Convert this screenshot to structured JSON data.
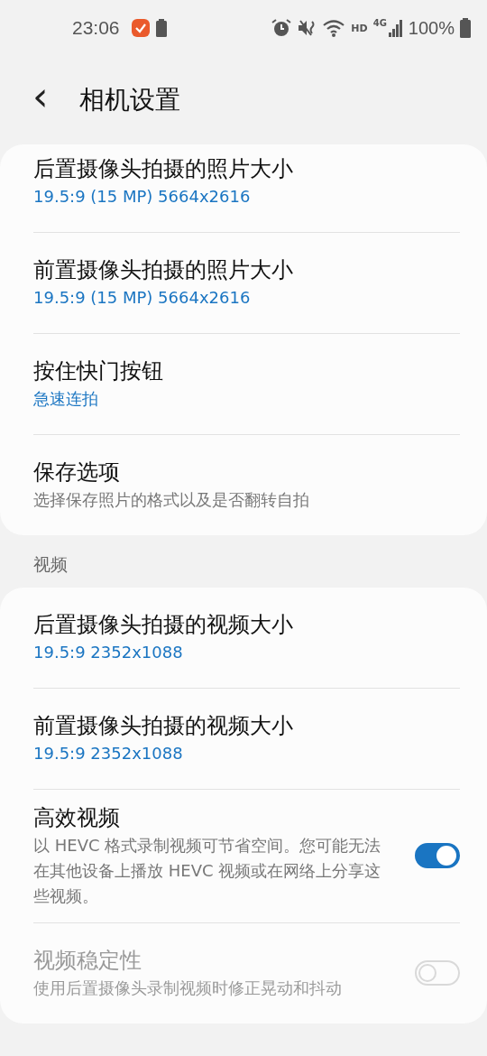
{
  "status_bar": {
    "time": "23:06",
    "battery_text": "100%",
    "network": "4G",
    "hd": "HD"
  },
  "header": {
    "back": "‹",
    "title": "相机设置"
  },
  "sections": [
    {
      "items": [
        {
          "title": "后置摄像头拍摄的照片大小",
          "subtitle": "19.5:9 (15 MP) 5664x2616",
          "kind": "value",
          "disabled": false
        },
        {
          "title": "前置摄像头拍摄的照片大小",
          "subtitle": "19.5:9 (15 MP) 5664x2616",
          "kind": "value",
          "disabled": false
        },
        {
          "title": "按住快门按钮",
          "subtitle": "急速连拍",
          "kind": "value",
          "disabled": false
        },
        {
          "title": "保存选项",
          "subtitle": "选择保存照片的格式以及是否翻转自拍",
          "kind": "description",
          "disabled": false
        }
      ]
    },
    {
      "header": "视频",
      "items": [
        {
          "title": "后置摄像头拍摄的视频大小",
          "subtitle": "19.5:9 2352x1088",
          "kind": "value",
          "disabled": false
        },
        {
          "title": "前置摄像头拍摄的视频大小",
          "subtitle": "19.5:9 2352x1088",
          "kind": "value",
          "disabled": false
        },
        {
          "title": "高效视频",
          "subtitle": "以 HEVC 格式录制视频可节省空间。您可能无法在其他设备上播放 HEVC 视频或在网络上分享这些视频。",
          "kind": "description",
          "disabled": false,
          "toggle": {
            "on": true
          }
        },
        {
          "title": "视频稳定性",
          "subtitle": "使用后置摄像头录制视频时修正晃动和抖动",
          "kind": "description",
          "disabled": true,
          "toggle": {
            "on": false
          }
        }
      ]
    }
  ]
}
